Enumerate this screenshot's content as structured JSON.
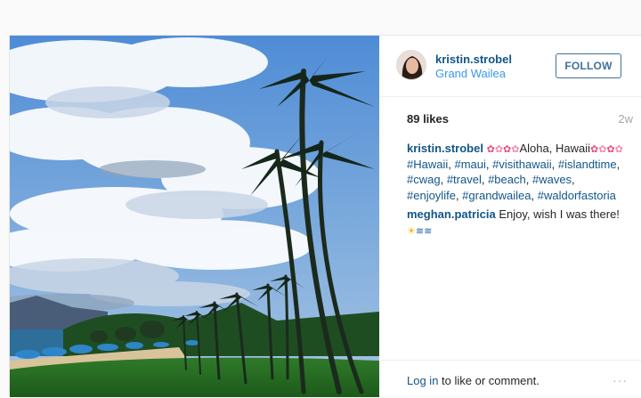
{
  "post": {
    "photo_description": "",
    "author": {
      "username": "kristin.strobel",
      "location": "Grand Wailea"
    },
    "follow_label": "FOLLOW",
    "likes": "89 likes",
    "age": "2w",
    "caption": {
      "user": "kristin.strobel",
      "text_aloha": "Aloha,",
      "text_hawaii": "Hawaii",
      "hashtags": [
        "#Hawaii",
        "#maui",
        "#visithawaii",
        "#islandtime",
        "#cwag",
        "#travel",
        "#beach",
        "#waves",
        "#enjoylife",
        "#grandwailea",
        "#waldorfastoria"
      ]
    },
    "reply": {
      "user": "meghan.patricia",
      "text": "Enjoy, wish I was there!"
    },
    "footer": {
      "login_link": "Log in",
      "login_rest": " to like or comment.",
      "more": "···"
    },
    "icons": {
      "flower": "hibiscus-emoji",
      "sun": "sun-emoji",
      "wave": "wave-emoji",
      "more": "more-options-icon"
    }
  }
}
